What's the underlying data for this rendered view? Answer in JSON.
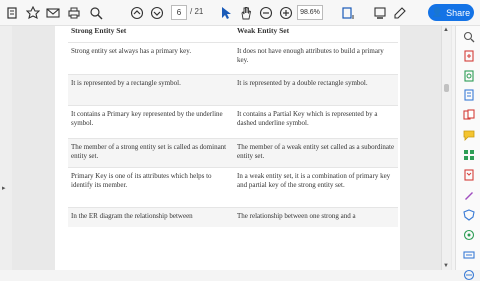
{
  "toolbar": {
    "page_current": "6",
    "page_total": "/ 21",
    "zoom": "98.6%",
    "share_label": "Share"
  },
  "table": {
    "headers": [
      "Strong Entity Set",
      "Weak Entity Set"
    ],
    "rows": [
      [
        "Strong entity set always has a primary key.",
        "It does not have enough attributes to build a primary key."
      ],
      [
        "It is represented by a rectangle symbol.",
        "It is represented by a double rectangle symbol."
      ],
      [
        "It contains a Primary key represented by the underline symbol.",
        "It contains a Partial Key which is represented by a dashed underline symbol."
      ],
      [
        "The member of a strong entity set is called as dominant entity set.",
        "The member of a weak entity set called as a subordinate entity set."
      ],
      [
        "Primary Key is one of its attributes which helps to identify its member.",
        "In a weak entity set, it is a combination of primary key and partial key of the strong entity set."
      ],
      [
        "In the ER diagram the relationship between",
        "The relationship between one strong and a"
      ]
    ]
  },
  "colors": {
    "accent": "#1473e6",
    "toolbar_bg": "#f7f7f7",
    "page_bg": "#ffffff"
  },
  "icons": {
    "toolbar": [
      "document-icon",
      "bookmark-icon",
      "email-icon",
      "print-icon",
      "search-icon",
      "page-up-icon",
      "page-down-icon",
      "select-cursor-icon",
      "hand-icon",
      "zoom-out-icon",
      "zoom-in-icon",
      "fit-page-icon",
      "highlight-icon",
      "comment-icon",
      "share-icon"
    ],
    "right_panel": [
      "search-panel-icon",
      "add-pdf-icon",
      "edit-pdf-icon",
      "export-pdf-icon",
      "combine-files-icon",
      "comment-panel-icon",
      "organize-pages-icon",
      "compress-pdf-icon",
      "fill-sign-icon",
      "protect-icon",
      "more-tools-icon",
      "scan-icon",
      "print-production-icon",
      "accessibility-icon"
    ]
  }
}
